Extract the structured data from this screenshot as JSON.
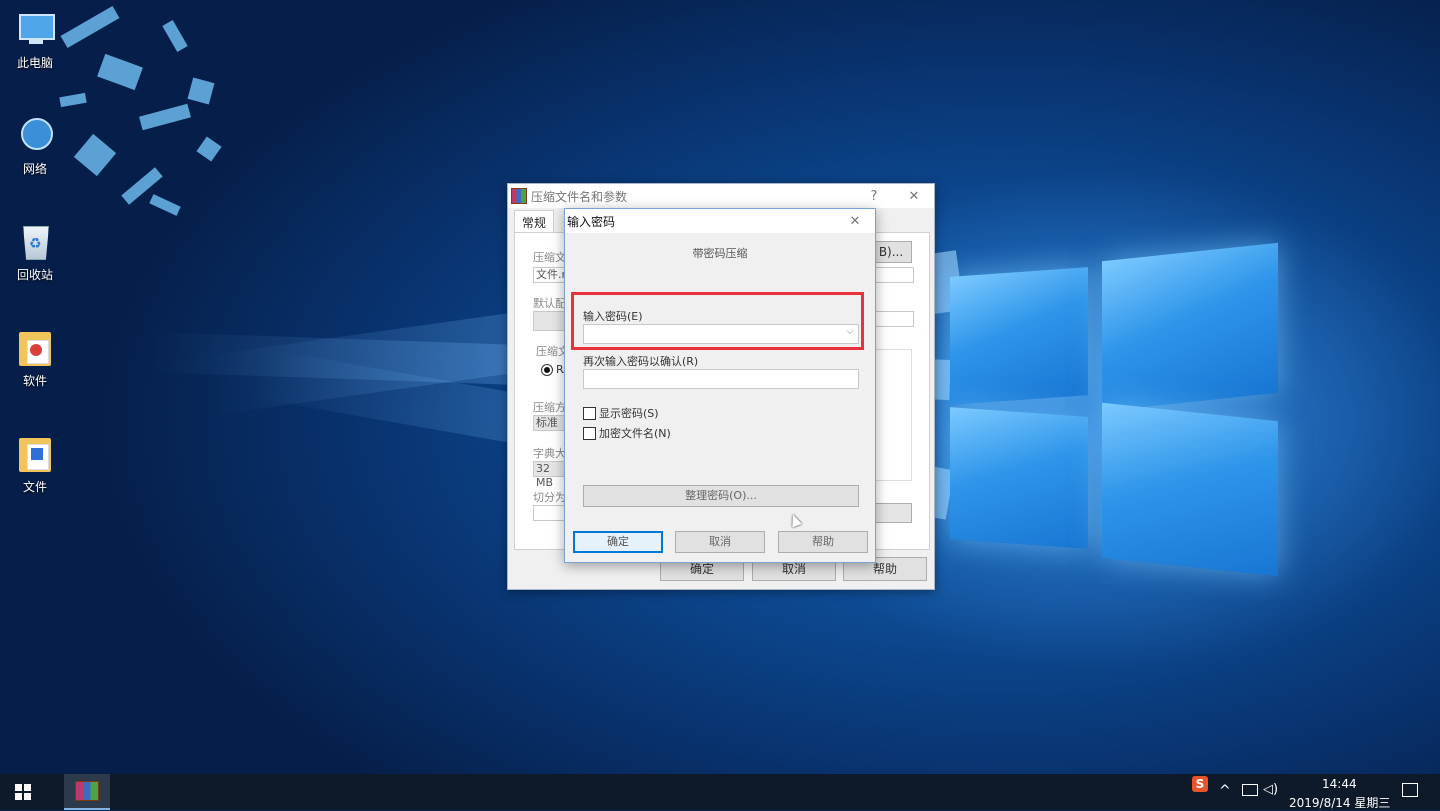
{
  "desktop": {
    "icons": [
      {
        "label": "此电脑",
        "icon": "computer-icon"
      },
      {
        "label": "网络",
        "icon": "network-icon"
      },
      {
        "label": "回收站",
        "icon": "recycle-bin-icon"
      },
      {
        "label": "软件",
        "icon": "folder-icon"
      },
      {
        "label": "文件",
        "icon": "folder-icon"
      }
    ]
  },
  "outer_dialog": {
    "title": "压缩文件名和参数",
    "help": "?",
    "close": "✕",
    "tab_general": "常规",
    "browse": "B)...",
    "fragments": {
      "archive_name_label": "压缩文",
      "archive_name_value": "文件.ra",
      "profile_label": "默认配",
      "format_group": "压缩文",
      "format_rar": "RA",
      "method_label": "压缩方",
      "method_value": "标准",
      "dict_label": "字典大",
      "dict_value": "32 MB",
      "split_label": "切分为"
    },
    "ok": "确定",
    "cancel": "取消",
    "help_btn": "帮助"
  },
  "password_dialog": {
    "title": "输入密码",
    "close": "✕",
    "caption": "带密码压缩",
    "password_label": "输入密码(E)",
    "password_value": "",
    "confirm_label": "再次输入密码以确认(R)",
    "confirm_value": "",
    "show_password": "显示密码(S)",
    "encrypt_names": "加密文件名(N)",
    "organize": "整理密码(O)...",
    "ok": "确定",
    "cancel": "取消",
    "help": "帮助"
  },
  "taskbar": {
    "time": "14:44",
    "date": "2019/8/14 星期三",
    "ime": "S"
  }
}
